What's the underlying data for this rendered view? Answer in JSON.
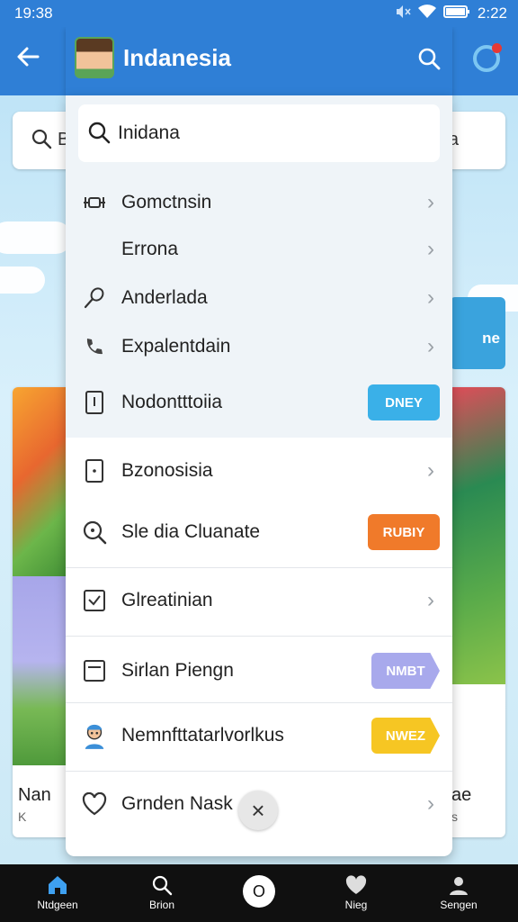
{
  "status_bar": {
    "time_left": "19:38",
    "time_right": "2:22"
  },
  "drawer": {
    "title": "Indanesia",
    "search_value": "Inidana",
    "items": [
      {
        "label": "Gomctnsin",
        "icon": "drone-icon",
        "trailing": "chevron"
      },
      {
        "label": "Errona",
        "icon": "",
        "trailing": "chevron"
      },
      {
        "label": "Anderlada",
        "icon": "pen-icon",
        "trailing": "chevron"
      },
      {
        "label": "Expalentdain",
        "icon": "phone-icon",
        "trailing": "chevron"
      },
      {
        "label": "Nodontttoiia",
        "icon": "tablet-icon",
        "trailing": "badge",
        "badge": "DNEY",
        "badge_color": "#3ab0e8"
      },
      {
        "label": "Bzonosisia",
        "icon": "tablet-icon",
        "trailing": "chevron"
      },
      {
        "label": "Sle dia Cluanate",
        "icon": "search-icon",
        "trailing": "badge",
        "badge": "RUBIY",
        "badge_color": "#f07a2a"
      },
      {
        "label": "Glreatinian",
        "icon": "checkbox-icon",
        "trailing": "chevron"
      },
      {
        "label": "Sirlan Piengn",
        "icon": "doc-icon",
        "trailing": "badge",
        "badge": "NMBT",
        "badge_color": "#a8a9ec"
      },
      {
        "label": "Nemnfttatarlvorlkus",
        "icon": "character-icon",
        "trailing": "badge",
        "badge": "NWEZ",
        "badge_color": "#f6c623"
      },
      {
        "label": "Grnden Nask",
        "icon": "heart-icon",
        "trailing": "chevron"
      }
    ],
    "close_label": "×"
  },
  "background": {
    "search_letter": "B",
    "search_right_letter": "a",
    "banner_text": "ne",
    "left_card_title": "Nan",
    "left_card_sub": "K",
    "right_card_title": "ae",
    "right_card_sub": "s"
  },
  "bottom_nav": [
    {
      "label": "Ntdgeen",
      "icon": "home-icon"
    },
    {
      "label": "Brion",
      "icon": "search-icon"
    },
    {
      "label": "O",
      "icon": "circle-button"
    },
    {
      "label": "Nieg",
      "icon": "heart-icon"
    },
    {
      "label": "Sengen",
      "icon": "person-icon"
    }
  ],
  "colors": {
    "primary": "#2f7fd6",
    "nav_bg": "#101010"
  }
}
